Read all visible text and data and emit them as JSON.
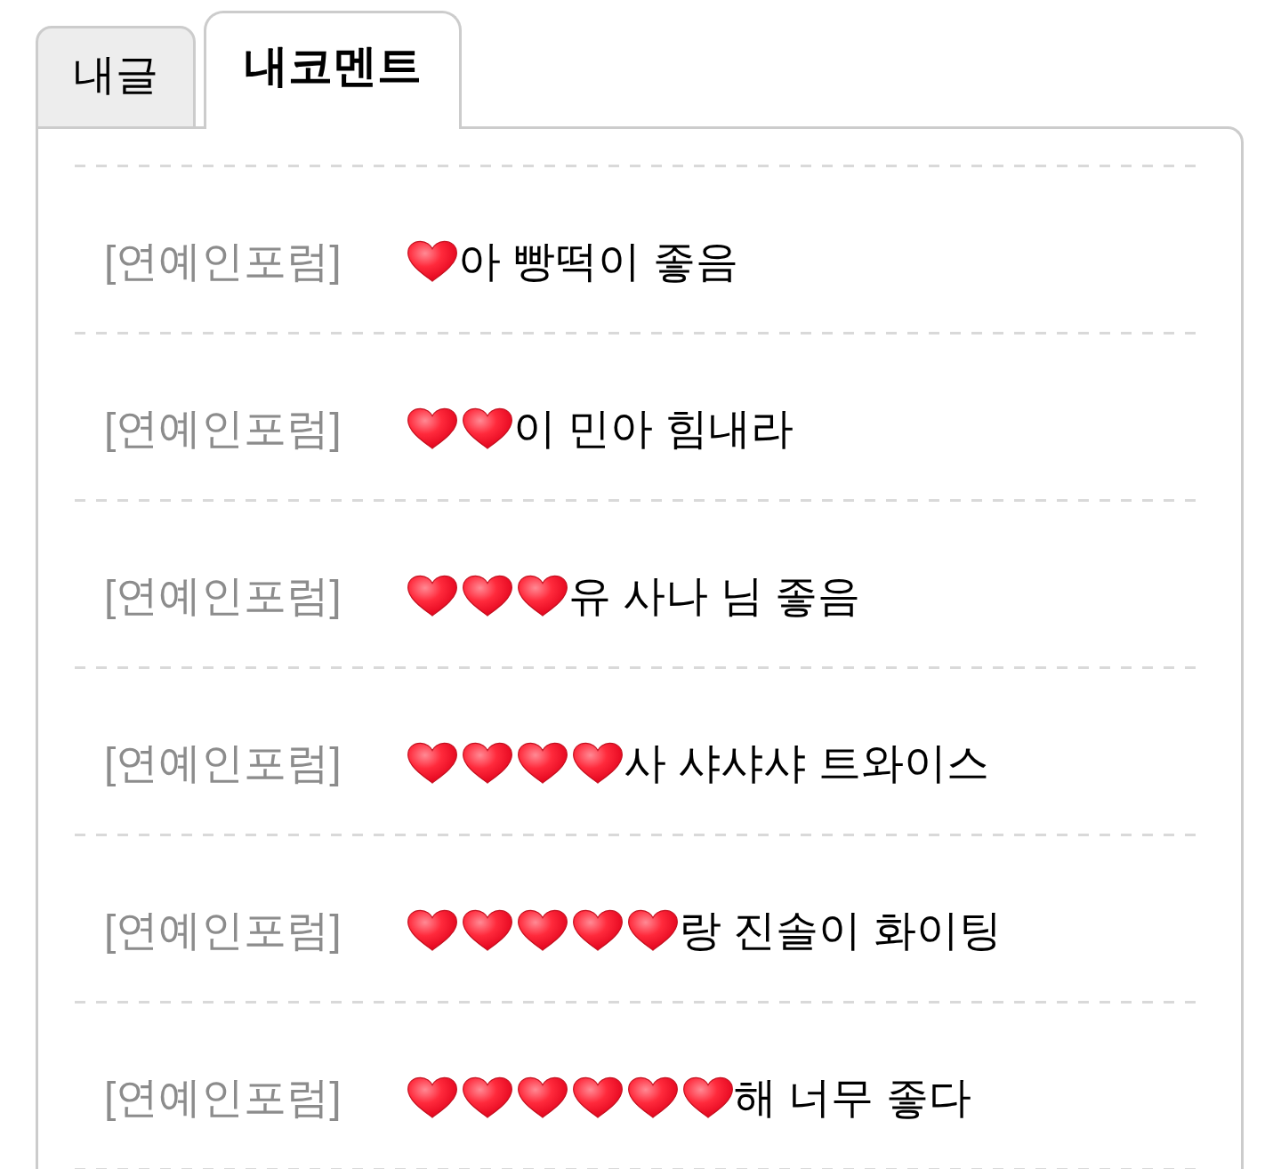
{
  "tabs": [
    {
      "label": "내글",
      "selected": false
    },
    {
      "label": "내코멘트",
      "selected": true
    }
  ],
  "comments": [
    {
      "board": "[연예인포럼]",
      "emoji": [
        {
          "kind": "heart"
        }
      ],
      "text": "아 빵떡이 좋음"
    },
    {
      "board": "[연예인포럼]",
      "emoji": [
        {
          "kind": "heart"
        },
        {
          "kind": "heart"
        }
      ],
      "text": "이 민아 힘내라"
    },
    {
      "board": "[연예인포럼]",
      "emoji": [
        {
          "kind": "heart"
        },
        {
          "kind": "heart"
        },
        {
          "kind": "heart"
        }
      ],
      "text": "유 사나 님 좋음"
    },
    {
      "board": "[연예인포럼]",
      "emoji": [
        {
          "kind": "heart"
        },
        {
          "kind": "heart"
        },
        {
          "kind": "heart"
        },
        {
          "kind": "heart"
        }
      ],
      "text": "사 샤샤샤 트와이스"
    },
    {
      "board": "[연예인포럼]",
      "emoji": [
        {
          "kind": "heart"
        },
        {
          "kind": "heart"
        },
        {
          "kind": "heart"
        },
        {
          "kind": "heart"
        },
        {
          "kind": "heart"
        }
      ],
      "text": "랑 진솔이 화이팅"
    },
    {
      "board": "[연예인포럼]",
      "emoji": [
        {
          "kind": "heart"
        },
        {
          "kind": "heart"
        },
        {
          "kind": "heart"
        },
        {
          "kind": "heart"
        },
        {
          "kind": "heart"
        },
        {
          "kind": "heart"
        }
      ],
      "text": "해 너무 좋다"
    }
  ]
}
